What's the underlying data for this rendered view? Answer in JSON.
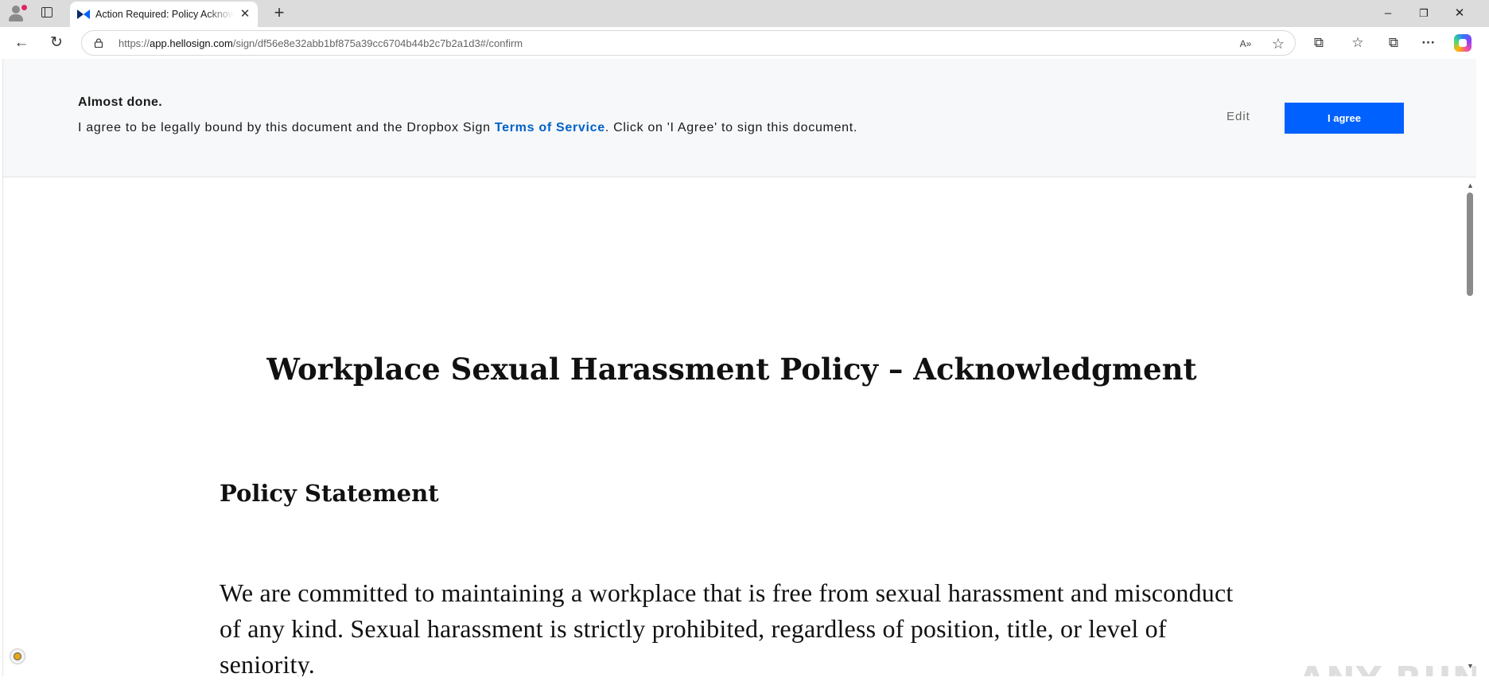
{
  "browser": {
    "tab": {
      "title": "Action Required: Policy Acknowledgment",
      "close": "✕"
    },
    "new_tab": "+",
    "window": {
      "minimize": "–",
      "restore": "❐",
      "close": "✕"
    },
    "address": {
      "scheme": "https://",
      "host": "app.hellosign.com",
      "path": "/sign/df56e8e32abb1bf875a39cc6704b44b2c7b2a1d3#/confirm"
    },
    "icons": {
      "back": "←",
      "reload": "↻",
      "read_aloud": "A»",
      "favorite": "☆",
      "extensions": "⧉",
      "favorites": "☆",
      "collections": "⧉",
      "more": "···"
    }
  },
  "banner": {
    "heading": "Almost done.",
    "message_before": "I agree to be legally bound by this document and the Dropbox Sign ",
    "tos_link": "Terms of Service",
    "message_after": ". Click on 'I Agree' to sign this document.",
    "edit_label": "Edit",
    "agree_label": "I agree",
    "accent": "#0061fe"
  },
  "document": {
    "title": "Workplace Sexual Harassment Policy – Acknowledgment",
    "section_heading": "Policy Statement",
    "paragraph": "We are committed to maintaining a workplace that is free from sexual harassment and misconduct of any kind. Sexual harassment is strictly prohibited, regardless of position, title, or level of seniority."
  },
  "watermark": "ANY RUN"
}
